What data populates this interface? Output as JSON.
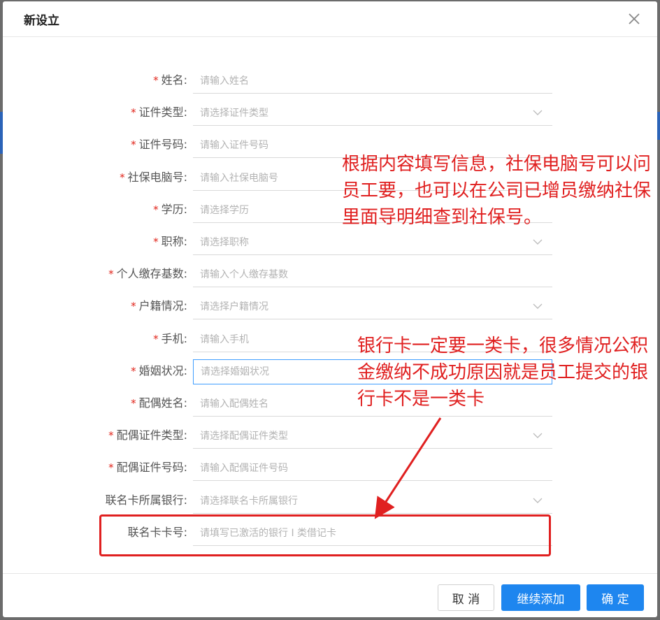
{
  "dialog": {
    "title": "新设立"
  },
  "form": {
    "fields": [
      {
        "label": "姓名:",
        "required": true,
        "placeholder": "请输入姓名",
        "kind": "input"
      },
      {
        "label": "证件类型:",
        "required": true,
        "placeholder": "请选择证件类型",
        "kind": "select"
      },
      {
        "label": "证件号码:",
        "required": true,
        "placeholder": "请输入证件号码",
        "kind": "input"
      },
      {
        "label": "社保电脑号:",
        "required": true,
        "placeholder": "请输入社保电脑号",
        "kind": "input"
      },
      {
        "label": "学历:",
        "required": true,
        "placeholder": "请选择学历",
        "kind": "input"
      },
      {
        "label": "职称:",
        "required": true,
        "placeholder": "请选择职称",
        "kind": "select"
      },
      {
        "label": "个人缴存基数:",
        "required": true,
        "placeholder": "请输入个人缴存基数",
        "kind": "input"
      },
      {
        "label": "户籍情况:",
        "required": true,
        "placeholder": "请选择户籍情况",
        "kind": "select"
      },
      {
        "label": "手机:",
        "required": true,
        "placeholder": "请输入手机",
        "kind": "input"
      },
      {
        "label": "婚姻状况:",
        "required": true,
        "placeholder": "请选择婚姻状况",
        "kind": "focused"
      },
      {
        "label": "配偶姓名:",
        "required": true,
        "placeholder": "请输入配偶姓名",
        "kind": "input"
      },
      {
        "label": "配偶证件类型:",
        "required": true,
        "placeholder": "请选择配偶证件类型",
        "kind": "select"
      },
      {
        "label": "配偶证件号码:",
        "required": true,
        "placeholder": "请输入配偶证件号码",
        "kind": "input"
      },
      {
        "label": "联名卡所属银行:",
        "required": false,
        "placeholder": "请选择联名卡所属银行",
        "kind": "select"
      },
      {
        "label": "联名卡卡号:",
        "required": false,
        "placeholder": "请填写已激活的银行 I 类借记卡",
        "kind": "input"
      }
    ]
  },
  "annotations": {
    "note1": "根据内容填写信息，社保电脑号可以问员工要，也可以在公司已增员缴纳社保里面导明细查到社保号。",
    "note2": "银行卡一定要一类卡，很多情况公积金缴纳不成功原因就是员工提交的银行卡不是一类卡"
  },
  "footer": {
    "cancel_label": "取 消",
    "continue_label": "继续添加",
    "ok_label": "确 定"
  },
  "colors": {
    "primary": "#1e86ef",
    "required_star": "#e1251b",
    "annotation": "#e02020",
    "focus_border": "#409eff"
  },
  "icons": {
    "close": "close-icon",
    "select_arrow": "chevron-down-icon"
  }
}
